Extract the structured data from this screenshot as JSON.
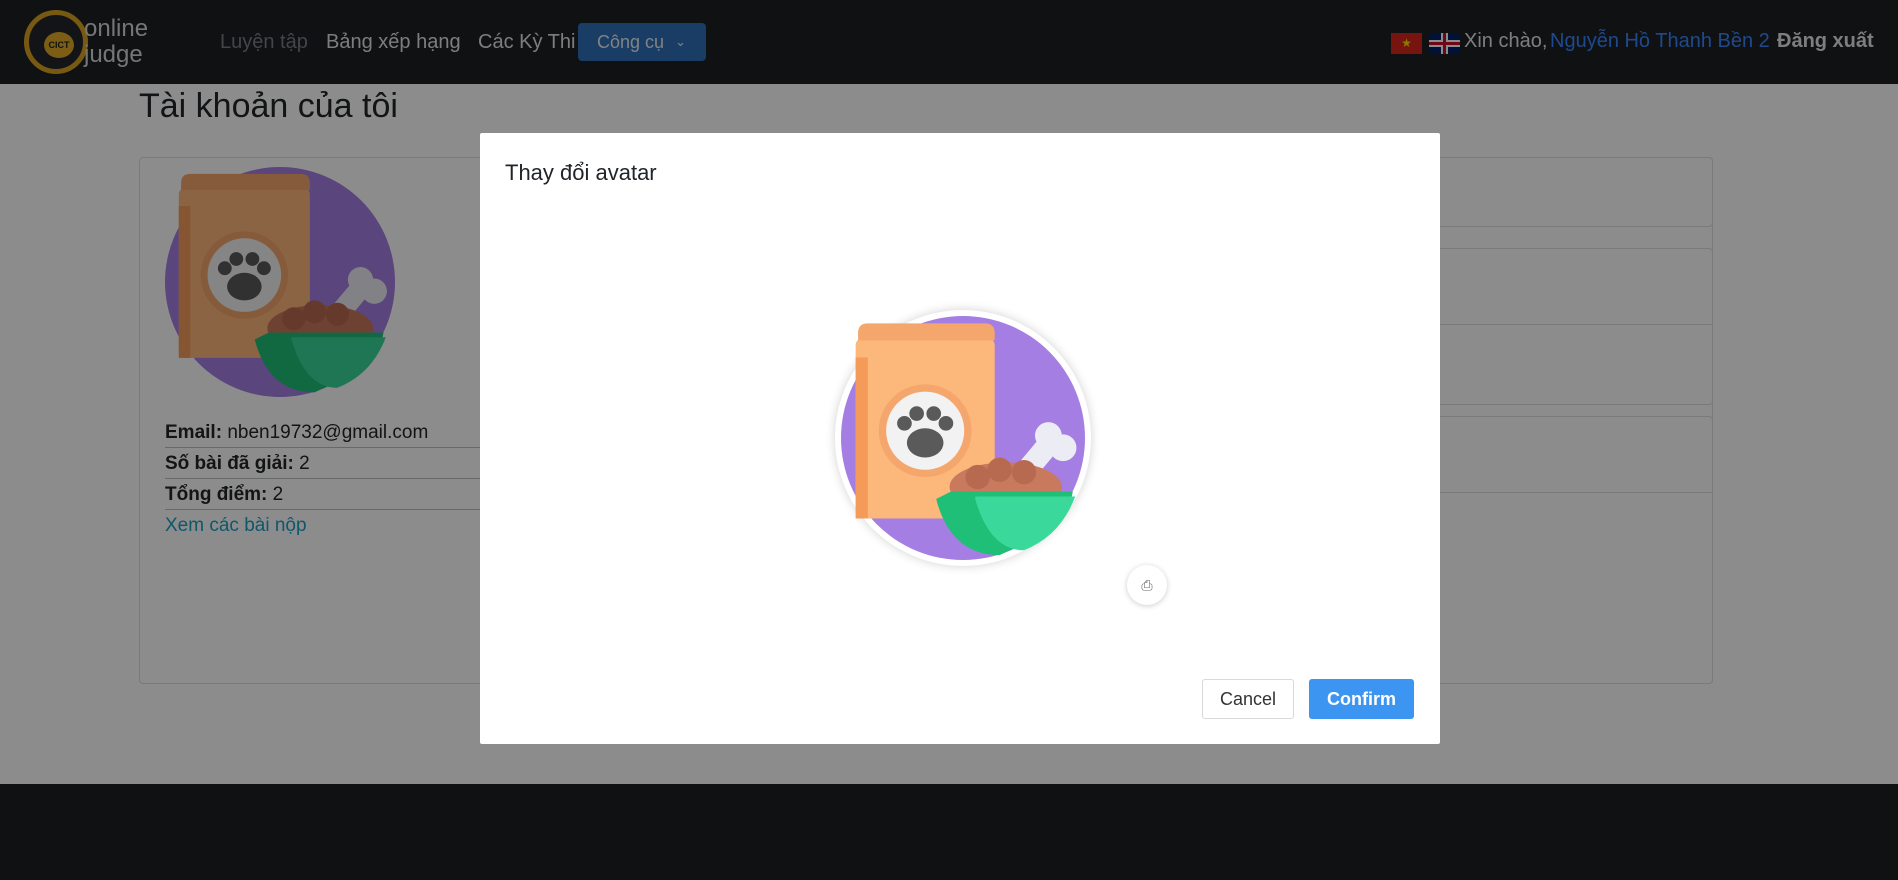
{
  "navbar": {
    "logo": {
      "emblem_text": "CICT",
      "line1": "online",
      "line2": "judge"
    },
    "nav_items": [
      "Luyện tập",
      "Bảng xếp hạng",
      "Các Kỳ Thi"
    ],
    "tools_label": "Công cụ",
    "greeting": "Xin chào,",
    "username": "Nguyễn Hồ Thanh Bền 2",
    "logout_label": "Đăng xuất",
    "icons": {
      "vn_flag": "vietnam-flag-icon",
      "uk_flag": "uk-flag-icon",
      "tools_chevron": "chevron-down-icon"
    }
  },
  "page": {
    "title": "Tài khoản của tôi",
    "profile": {
      "email_label": "Email:",
      "email_value": "nben19732@gmail.com",
      "solved_label": "Số bài đã giải:",
      "solved_value": "2",
      "score_label": "Tổng điểm:",
      "score_value": "2",
      "submissions_link": "Xem các bài nộp"
    }
  },
  "modal": {
    "title": "Thay đổi avatar",
    "cancel_label": "Cancel",
    "confirm_label": "Confirm",
    "upload_icon": "upload-icon",
    "upload_glyph": "⎙"
  },
  "colors": {
    "navbar_bg": "#1c1f24",
    "link_blue": "#3a86ff",
    "tools_button": "#2f6fb8",
    "confirm_button": "#3d95f2",
    "avatar_purple": "#a57ee3",
    "bag_orange": "#fcb77a",
    "bowl_green": "#32d48f"
  }
}
